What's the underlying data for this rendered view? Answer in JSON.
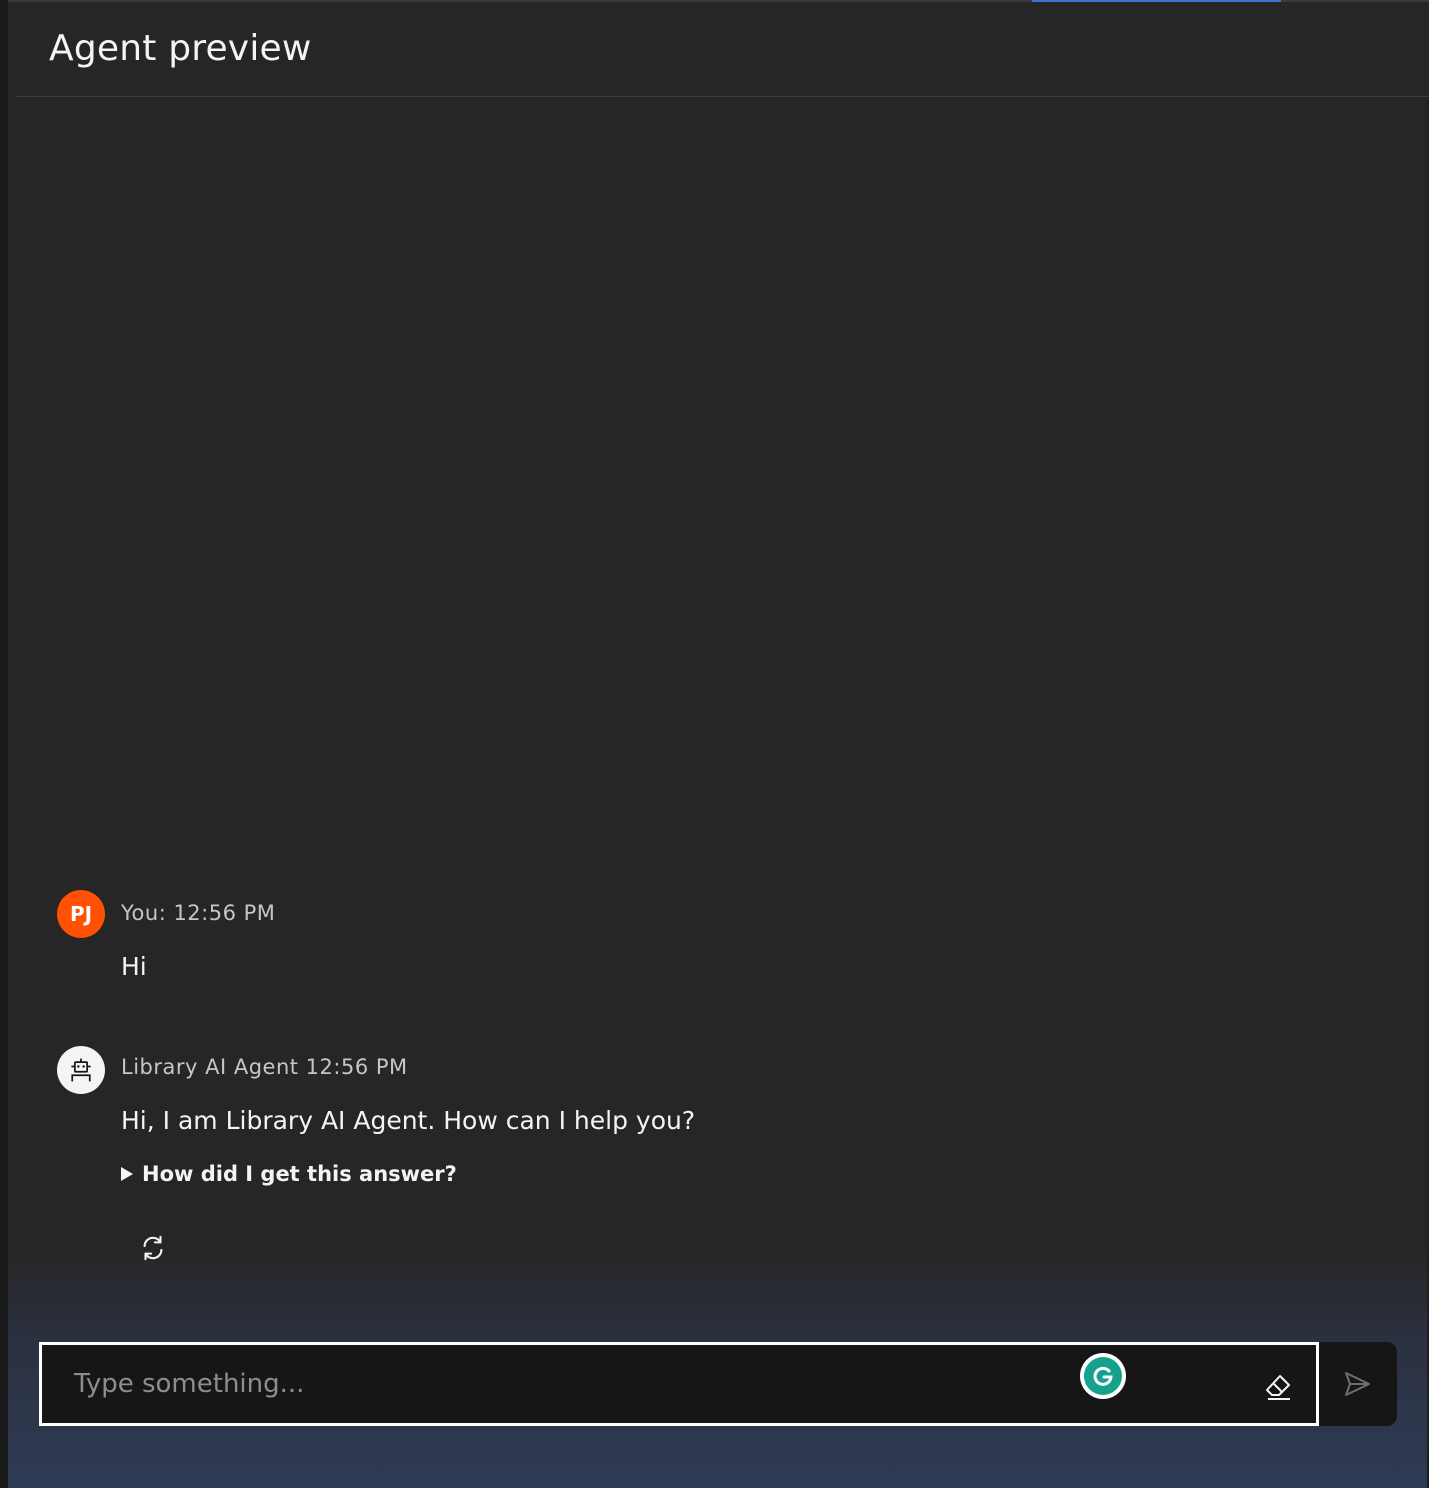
{
  "header": {
    "title": "Agent preview"
  },
  "messages": {
    "user": {
      "initials": "PJ",
      "meta": "You: 12:56 PM",
      "text": "Hi"
    },
    "agent": {
      "meta": "Library AI Agent 12:56 PM",
      "text": "Hi, I am Library AI Agent. How can I help you?",
      "explain_label": "How did I get this answer?"
    }
  },
  "composer": {
    "placeholder": "Type something..."
  },
  "icons": {
    "bot": "robot-icon",
    "regenerate": "regenerate-icon",
    "grammarly": "grammarly-icon",
    "clear": "eraser-icon",
    "send": "send-icon"
  },
  "colors": {
    "user_avatar": "#ff5003",
    "focus_border": "#ffffff",
    "accent": "#3b6fd6",
    "grammarly": "#15a18b"
  }
}
